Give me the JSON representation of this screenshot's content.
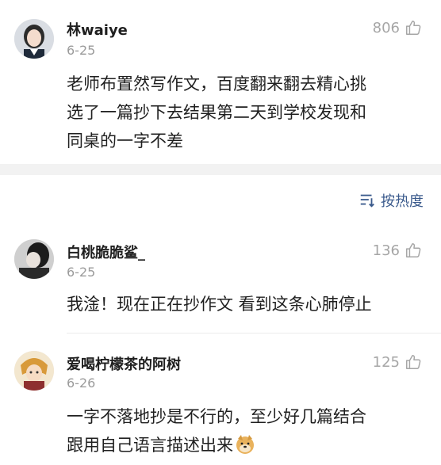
{
  "top_comment": {
    "user": "林waiye",
    "date": "6-25",
    "likes": "806",
    "lines": [
      "老师布置然写作文，百度翻来翻去精心挑",
      "选了一篇抄下去结果第二天到学校发现和",
      "同桌的一字不差"
    ]
  },
  "sort": {
    "label": "按热度"
  },
  "replies": [
    {
      "user": "白桃脆脆鲨_",
      "date": "6-25",
      "likes": "136",
      "lines": [
        "我淦！现在正在抄作文 看到这条心肺停止"
      ]
    },
    {
      "user": "爱喝柠檬茶的阿树",
      "date": "6-26",
      "likes": "125",
      "lines": [
        "一字不落地抄是不行的，至少好几篇结合",
        "跟用自己语言描述出来"
      ]
    }
  ],
  "icons": {
    "like": "thumbs-up-icon",
    "sort": "sort-lines-icon",
    "emoji": "doge-emoji-icon"
  },
  "colors": {
    "sort_accent": "#3a5a8c",
    "muted": "#9b9b9b",
    "divider_band": "#f2f2f2"
  }
}
